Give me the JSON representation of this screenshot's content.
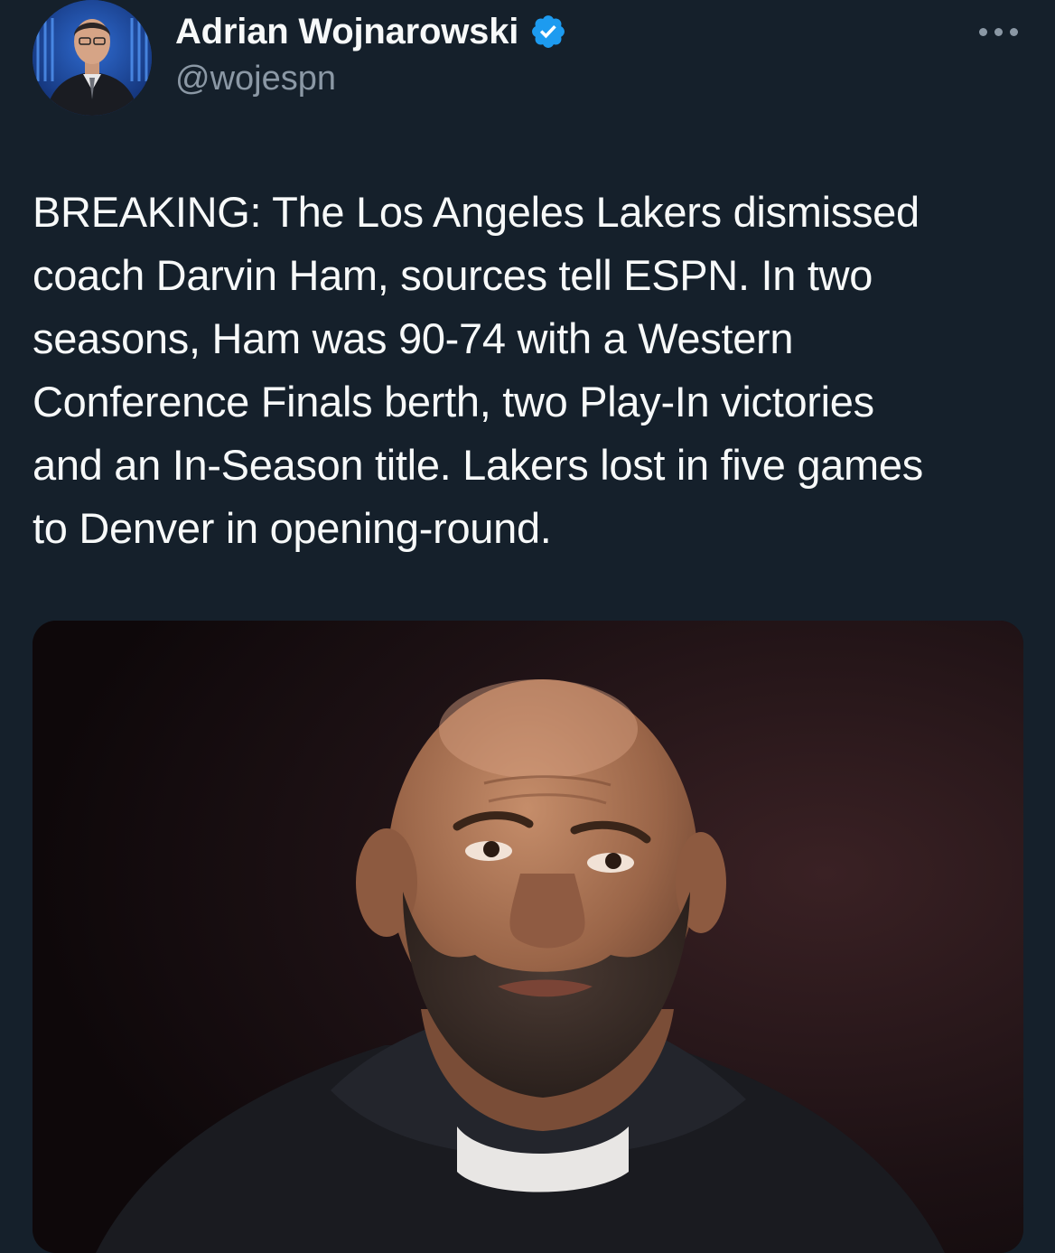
{
  "author": {
    "display_name": "Adrian Wojnarowski",
    "handle": "@wojespn",
    "verified": true,
    "avatar_icon": "profile-photo"
  },
  "tweet": {
    "text_lines": [
      "BREAKING: The Los Angeles Lakers dismissed",
      "coach Darvin Ham, sources tell ESPN. In two",
      "seasons, Ham was 90-74 with a Western",
      "Conference Finals berth, two Play-In victories",
      "and an In-Season title. Lakers lost in five games",
      "to Denver in opening-round."
    ]
  },
  "icons": {
    "more": "more-horizontal-icon",
    "verified": "verified-badge-icon"
  },
  "colors": {
    "background": "#15202b",
    "text_primary": "#f7f9f9",
    "text_secondary": "#8b98a5",
    "verified_blue": "#1d9bf0"
  }
}
